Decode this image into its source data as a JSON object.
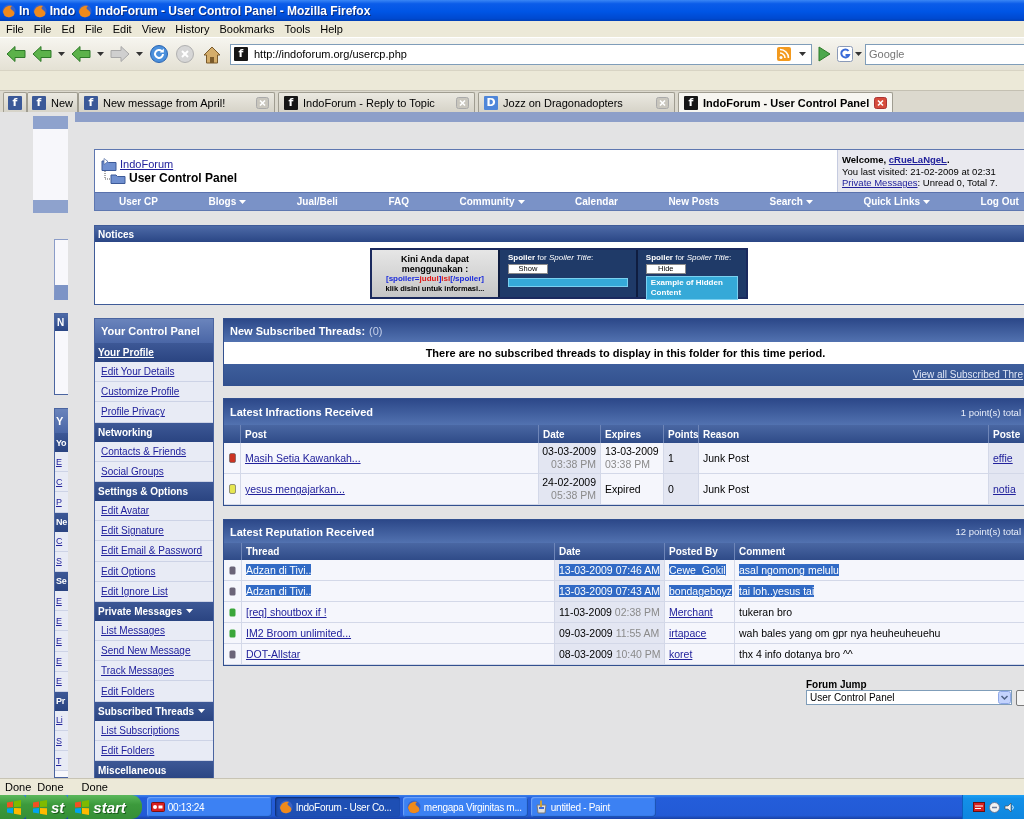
{
  "window": {
    "title": "IndoForum - User Control Panel - Mozilla Firefox",
    "ghost_titles": [
      "In",
      "Indo"
    ]
  },
  "menu": [
    "File",
    "File",
    "Ed",
    "File",
    "Edit",
    "View",
    "History",
    "Bookmarks",
    "Tools",
    "Help"
  ],
  "address_bar": {
    "icon": "f",
    "value": "http://indoforum.org/usercp.php"
  },
  "search": {
    "placeholder": "Google"
  },
  "tabs": [
    {
      "icon": "f",
      "kind": "social",
      "closable": false,
      "selected": false
    },
    {
      "icon": "f",
      "kind": "social",
      "label": "New",
      "closable": false,
      "selected": false
    },
    {
      "icon": "f",
      "kind": "social",
      "label": "New message from April!",
      "closable": true,
      "selected": false
    },
    {
      "icon": "f",
      "kind": "forum",
      "label": "IndoForum - Reply to Topic",
      "closable": true,
      "selected": false
    },
    {
      "icon": "D",
      "kind": "letter",
      "label": "Jozz on Dragonadopters",
      "closable": true,
      "selected": false
    },
    {
      "icon": "f",
      "kind": "forum",
      "label": "IndoForum - User Control Panel",
      "closable": true,
      "selected": true
    }
  ],
  "ghost": {
    "notice_title": "N",
    "sidebar": [
      {
        "text": "Y",
        "kind": "title"
      },
      {
        "text": "Yo",
        "kind": "header"
      },
      {
        "text": "E",
        "kind": "item"
      },
      {
        "text": "C",
        "kind": "item"
      },
      {
        "text": "P",
        "kind": "item"
      },
      {
        "text": "Ne",
        "kind": "header"
      },
      {
        "text": "C",
        "kind": "item"
      },
      {
        "text": "S",
        "kind": "item"
      },
      {
        "text": "Se",
        "kind": "header"
      },
      {
        "text": "E",
        "kind": "item"
      },
      {
        "text": "E",
        "kind": "item"
      },
      {
        "text": "E",
        "kind": "item"
      },
      {
        "text": "E",
        "kind": "item"
      },
      {
        "text": "E",
        "kind": "item"
      },
      {
        "text": "Pr",
        "kind": "header"
      },
      {
        "text": "Li",
        "kind": "item"
      },
      {
        "text": "S",
        "kind": "item"
      },
      {
        "text": "T",
        "kind": "item"
      }
    ]
  },
  "breadcrumb": {
    "parent": "IndoForum",
    "current": "User Control Panel"
  },
  "welcome": {
    "prefix": "Welcome,",
    "user": "cRueLaNgeL",
    "suffix": ".",
    "last_visited": "You last visited: 21-02-2009 at 02:31",
    "messages_link": "Private Messages",
    "messages_text": ": Unread 0, Total 7."
  },
  "navbar": [
    {
      "label": "User CP",
      "dropdown": false
    },
    {
      "label": "Blogs",
      "dropdown": true
    },
    {
      "label": "Jual/Beli",
      "dropdown": false
    },
    {
      "label": "FAQ",
      "dropdown": false
    },
    {
      "label": "Community",
      "dropdown": true
    },
    {
      "label": "Calendar",
      "dropdown": false
    },
    {
      "label": "New Posts",
      "dropdown": false
    },
    {
      "label": "Search",
      "dropdown": true
    },
    {
      "label": "Quick Links",
      "dropdown": true
    },
    {
      "label": "Log Out",
      "dropdown": false
    }
  ],
  "notices": {
    "title": "Notices",
    "banner": {
      "intro": "Kini Anda dapat menggunakan :",
      "code": [
        {
          "text": "[spoiler=",
          "kind": "tag"
        },
        {
          "text": "judul",
          "kind": "value"
        },
        {
          "text": "]",
          "kind": "tag"
        },
        {
          "text": "isi",
          "kind": "value"
        },
        {
          "text": "[/spoiler]",
          "kind": "tag"
        }
      ],
      "hint": "klik disini untuk informasi...",
      "spoilers": [
        {
          "title": "**Spoiler** for *Spoiler Title*:",
          "button": "Show",
          "expanded": false
        },
        {
          "title": "**Spoiler** for *Spoiler Title*:",
          "button": "Hide",
          "expanded": true,
          "content": "Example of Hidden Content"
        }
      ]
    }
  },
  "sidebar": {
    "title": "Your Control Panel",
    "sections": [
      {
        "label": "Your Profile",
        "kind": "link",
        "collapsible": false,
        "items": [
          "Edit Your Details",
          "Customize Profile",
          "Profile Privacy"
        ]
      },
      {
        "label": "Networking",
        "kind": "label",
        "collapsible": false,
        "items": [
          "Contacts & Friends",
          "Social Groups"
        ]
      },
      {
        "label": "Settings & Options",
        "kind": "label",
        "collapsible": false,
        "items": [
          "Edit Avatar",
          "Edit Signature",
          "Edit Email & Password",
          "Edit Options",
          "Edit Ignore List"
        ]
      },
      {
        "label": "Private Messages",
        "kind": "label",
        "collapsible": true,
        "items": [
          "List Messages",
          "Send New Message",
          "Track Messages",
          "Edit Folders"
        ]
      },
      {
        "label": "Subscribed Threads",
        "kind": "label",
        "collapsible": true,
        "items": [
          "List Subscriptions",
          "Edit Folders"
        ]
      },
      {
        "label": "Miscellaneous",
        "kind": "label",
        "collapsible": false
      }
    ]
  },
  "subscribed": {
    "title": "New Subscribed Threads:",
    "count": "(0)",
    "message": "There are no subscribed threads to display in this folder for this time period.",
    "footer_link": "View all Subscribed Thre"
  },
  "infractions": {
    "title": "Latest Infractions Received",
    "total": "1 point(s) total",
    "columns": [
      "Post",
      "Date",
      "Expires",
      "Points",
      "Reason",
      "Poste"
    ],
    "rows": [
      {
        "color": "#cc3322",
        "post": "Masih Setia Kawankah...",
        "date": "03-03-2009",
        "time": "03:38 PM",
        "expires": "13-03-2009",
        "expires_time": "03:38 PM",
        "points": "1",
        "reason": "Junk Post",
        "poster": "effie"
      },
      {
        "color": "#e6e650",
        "post": "yesus mengajarkan...",
        "date": "24-02-2009",
        "time": "05:38 PM",
        "expires": "Expired",
        "points": "0",
        "reason": "Junk Post",
        "poster": "notia"
      }
    ]
  },
  "reputation": {
    "title": "Latest Reputation Received",
    "total": "12 point(s) total",
    "columns": [
      "Thread",
      "Date",
      "Posted By",
      "Comment"
    ],
    "rows": [
      {
        "color": "#6b6478",
        "highlighted": true,
        "thread": "Adzan di Tivi..",
        "date": "13-03-2009",
        "time": "07:46 AM",
        "posted_by": "Cewe_Gokil",
        "comment": "asal ngomong melulu"
      },
      {
        "color": "#6b6478",
        "highlighted": true,
        "thread": "Adzan di Tivi..",
        "date": "13-03-2009",
        "time": "07:43 AM",
        "posted_by": "bondageboyz",
        "comment": "tai loh..yesus tai"
      },
      {
        "color": "#3aa63a",
        "highlighted": false,
        "thread": "[req] shoutbox if !",
        "date": "11-03-2009",
        "time": "02:38 PM",
        "posted_by": "Merchant",
        "comment": "tukeran bro"
      },
      {
        "color": "#3aa63a",
        "highlighted": false,
        "thread": "IM2 Broom unlimited...",
        "date": "09-03-2009",
        "time": "11:55 AM",
        "posted_by": "irtapace",
        "comment": "wah bales yang om gpr nya heuheuheuehu"
      },
      {
        "color": "#6b6478",
        "highlighted": false,
        "thread": "DOT-Allstar",
        "date": "08-03-2009",
        "time": "10:40 PM",
        "posted_by": "koret",
        "comment": "thx 4 info dotanya bro ^^"
      }
    ]
  },
  "forum_jump": {
    "label": "Forum Jump",
    "value": "User Control Panel"
  },
  "status_bar": [
    "Done",
    "Done",
    "Done"
  ],
  "taskbar": {
    "start_buttons": [
      {
        "kind": "ghost"
      },
      {
        "kind": "ghost",
        "label": "st"
      },
      {
        "kind": "full",
        "label": "start"
      }
    ],
    "items": [
      {
        "kind": "recorder",
        "label": "00:13:24",
        "selected": false
      },
      {
        "kind": "browser",
        "label": "IndoForum - User Co...",
        "selected": true
      },
      {
        "kind": "browser",
        "label": "mengapa Virginitas m...",
        "selected": false
      },
      {
        "kind": "paint",
        "label": "untitled - Paint",
        "selected": false
      }
    ]
  }
}
